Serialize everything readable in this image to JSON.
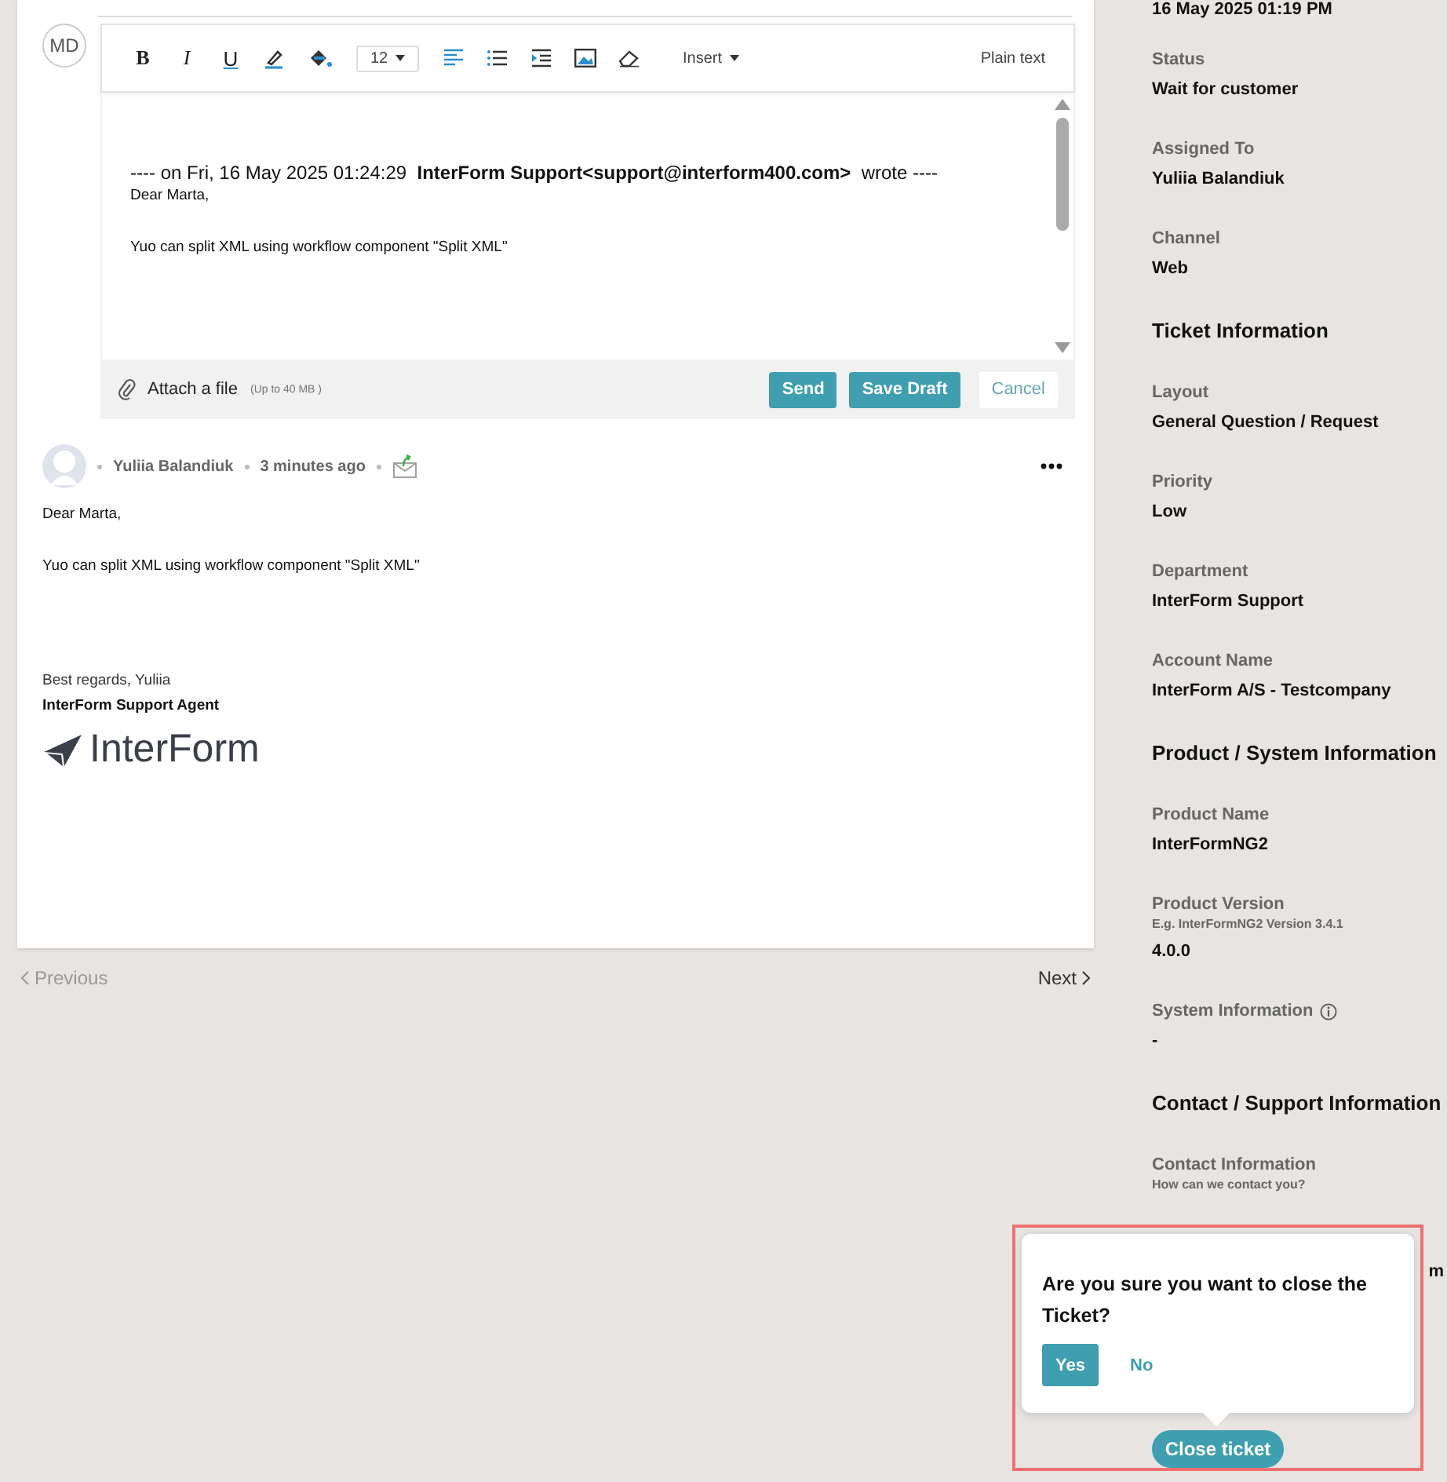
{
  "editor": {
    "author_initials": "MD",
    "toolbar": {
      "format_buttons": [
        {
          "kind": "bold",
          "label": "B"
        },
        {
          "kind": "italic",
          "label": "I"
        },
        {
          "kind": "underline",
          "label": "U"
        }
      ],
      "font_size": "12",
      "insert_label": "Insert",
      "mode_label": "Plain text"
    },
    "quote_header": "---- on Fri, 16 May 2025 01:24:29  **InterForm Support<support@interform400.com>**  wrote ----",
    "body_lines": [
      "Dear Marta,",
      "Yuo can split XML using workflow component \"Split XML\""
    ],
    "attach_label": "Attach a file",
    "attach_limit": "(Up to 40 MB )",
    "buttons": [
      {
        "kind": "primary",
        "label": "Send"
      },
      {
        "kind": "primary",
        "label": "Save Draft"
      },
      {
        "kind": "plain",
        "label": "Cancel"
      }
    ]
  },
  "message": {
    "author": "Yuliia Balandiuk",
    "time": "3 minutes ago",
    "body_lines": [
      "Dear Marta,",
      "Yuo can split XML using workflow component \"Split XML\""
    ],
    "signature": {
      "greeting": "Best regards, Yuliia",
      "role": "InterForm Support Agent",
      "logo_text": "InterForm"
    }
  },
  "pager": {
    "previous": "Previous",
    "next": "Next"
  },
  "sidebar": [
    {
      "kind": "value",
      "value": "16 May 2025 01:19 PM"
    },
    {
      "kind": "field",
      "label": "Status",
      "value": "Wait for customer"
    },
    {
      "kind": "field",
      "label": "Assigned To",
      "value": "Yuliia Balandiuk"
    },
    {
      "kind": "field",
      "label": "Channel",
      "value": "Web"
    },
    {
      "kind": "heading",
      "label": "Ticket Information"
    },
    {
      "kind": "field",
      "label": "Layout",
      "value": "General Question / Request"
    },
    {
      "kind": "field",
      "label": "Priority",
      "value": "Low"
    },
    {
      "kind": "field",
      "label": "Department",
      "value": "InterForm Support"
    },
    {
      "kind": "field",
      "label": "Account Name",
      "value": "InterForm A/S - Testcompany"
    },
    {
      "kind": "heading",
      "label": "Product / System Information"
    },
    {
      "kind": "field",
      "label": "Product Name",
      "value": "InterFormNG2"
    },
    {
      "kind": "field",
      "label": "Product Version",
      "hint": "E.g. InterFormNG2 Version 3.4.1",
      "value": "4.0.0"
    },
    {
      "kind": "field",
      "label": "System Information",
      "info": true,
      "value": "-"
    },
    {
      "kind": "heading",
      "label": "Contact / Support Information"
    },
    {
      "kind": "field",
      "label": "Contact Information",
      "hint": "How can we contact you?"
    },
    {
      "kind": "fragment",
      "value": "m"
    }
  ],
  "confirm_popup": {
    "question": "Are you sure you want to close the Ticket?",
    "yes": "Yes",
    "no": "No"
  },
  "close_ticket": "Close ticket"
}
